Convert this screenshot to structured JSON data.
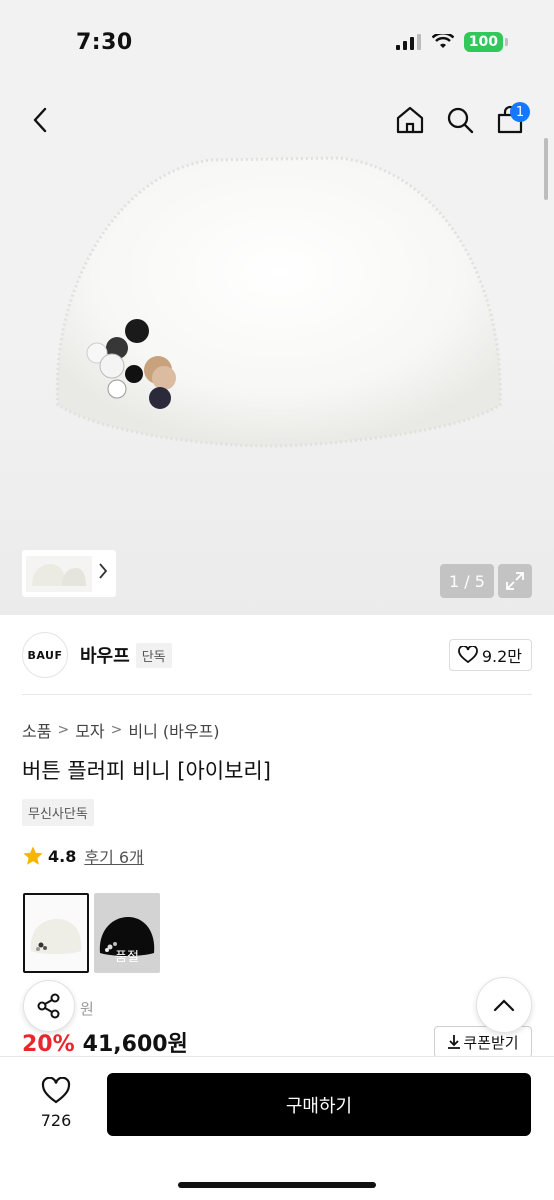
{
  "status_bar": {
    "time": "7:30",
    "battery": "100"
  },
  "header": {
    "cart_count": "1"
  },
  "gallery": {
    "counter": "1 / 5",
    "main_image_desc": "white fluffy beanie with buttons"
  },
  "brand": {
    "logo_text": "BAUF",
    "name": "바우프",
    "tag": "단독",
    "like_count": "9.2만"
  },
  "breadcrumb": [
    "소품",
    "모자",
    "비니 (바우프)"
  ],
  "product": {
    "title": "버튼 플러피 비니 [아이보리]",
    "exclusive_badge": "무신사단독",
    "rating": "4.8",
    "review_link": "후기 6개"
  },
  "colors": [
    {
      "name": "ivory",
      "selected": true
    },
    {
      "name": "black",
      "soldout_label": "품절"
    }
  ],
  "pricing": {
    "original_price_fragment": "원",
    "discount": "20%",
    "price": "41,600원",
    "coupon_label": "쿠폰받기"
  },
  "bottom_bar": {
    "wish_count": "726",
    "buy_label": "구매하기"
  },
  "colors_theme": {
    "accent_red": "#e9262d",
    "badge_blue": "#1677ff",
    "battery_green": "#32c759"
  }
}
